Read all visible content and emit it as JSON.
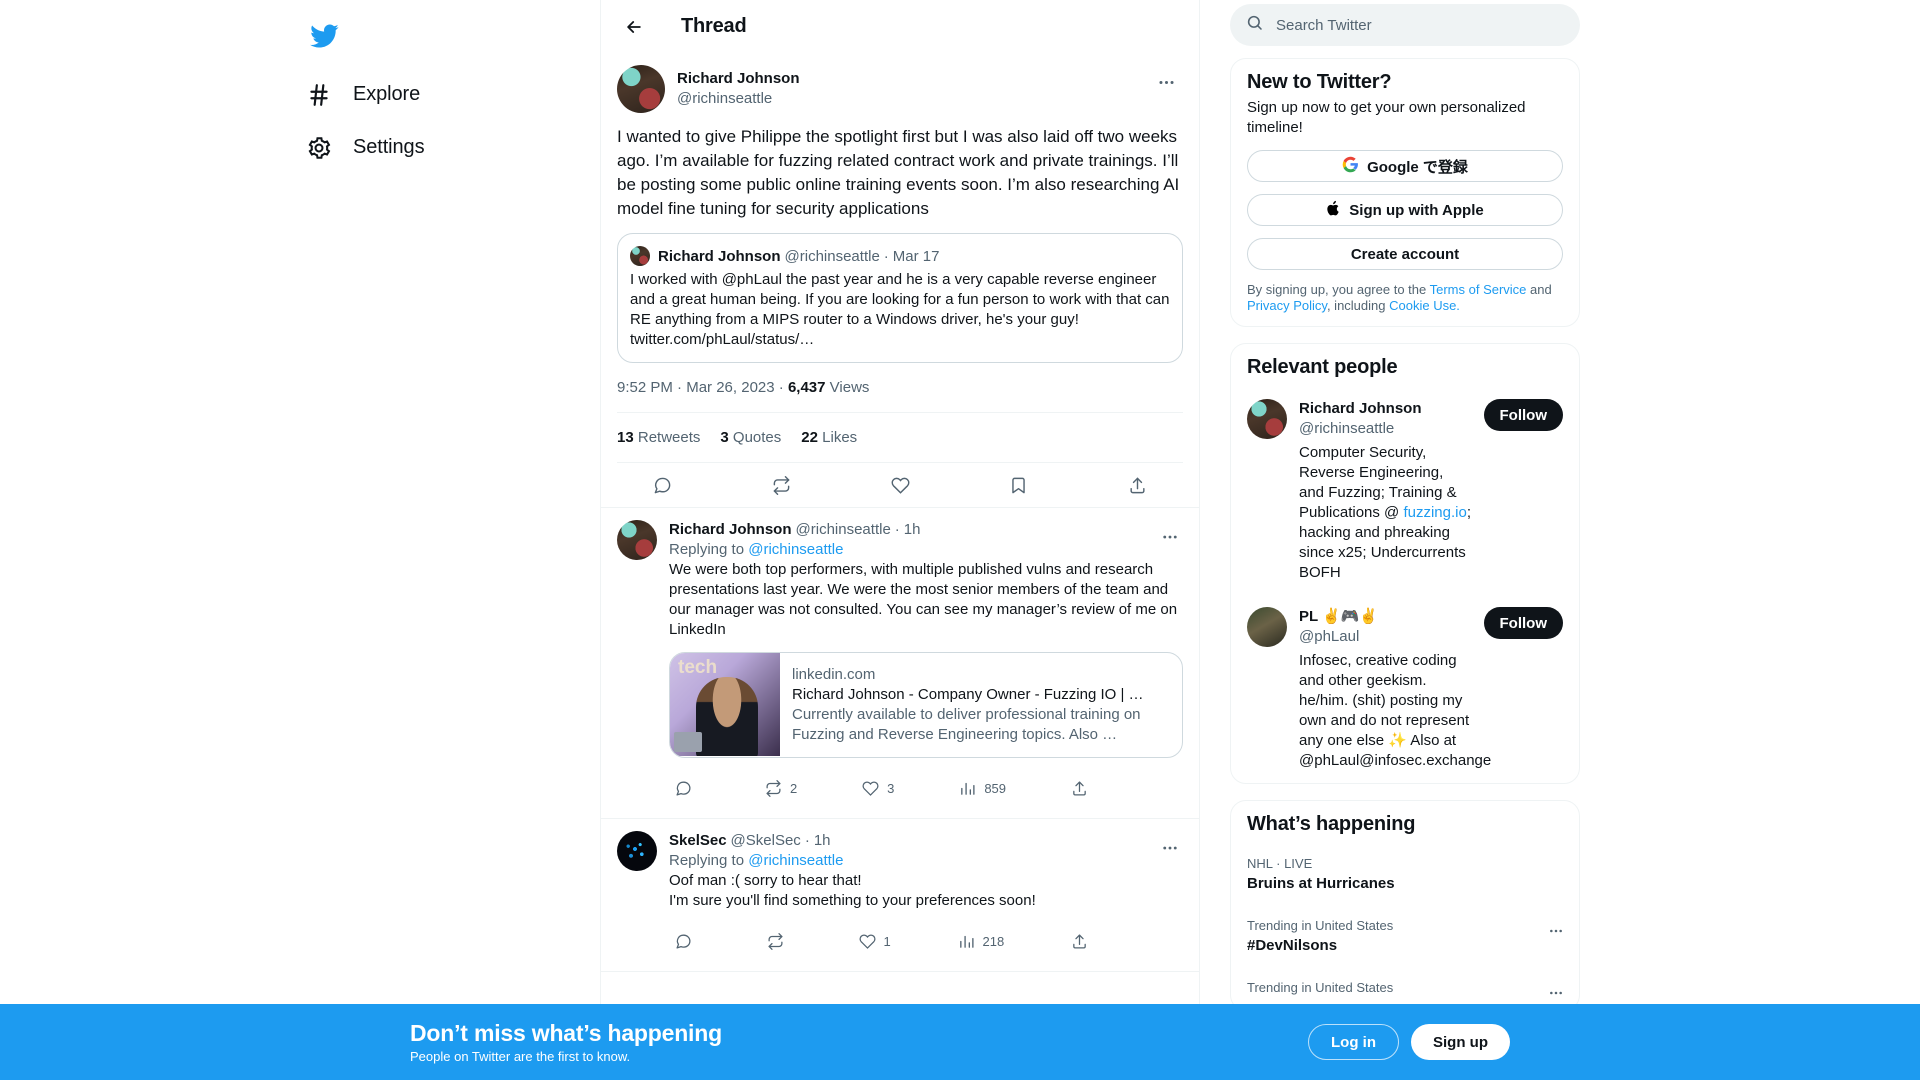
{
  "nav": {
    "logo_icon": "twitter-bird-icon",
    "items": [
      {
        "label": "Explore",
        "icon": "hashtag-icon"
      },
      {
        "label": "Settings",
        "icon": "gear-icon"
      }
    ]
  },
  "thread": {
    "header_title": "Thread",
    "back_icon": "back-arrow-icon",
    "main_tweet": {
      "author_name": "Richard Johnson",
      "author_handle": "@richinseattle",
      "text": "I wanted to give Philippe the spotlight first but I was also laid off two weeks ago. I’m available for fuzzing related contract work and private trainings. I’ll be posting some public online training events soon. I’m also researching AI model fine tuning for security applications",
      "quote": {
        "author_name": "Richard Johnson",
        "author_handle": "@richinseattle",
        "date": "Mar 17",
        "separator": "·",
        "text": "I worked with @phLaul the past year and he is a very capable reverse engineer and a great human being. If you are looking for a fun person to work with that can RE anything from a MIPS router to a Windows driver, he's your guy! twitter.com/phLaul/status/…"
      },
      "time": "9:52 PM",
      "date": "Mar 26, 2023",
      "views_count": "6,437",
      "views_label": "Views",
      "stats": [
        {
          "count": "13",
          "label": "Retweets"
        },
        {
          "count": "3",
          "label": "Quotes"
        },
        {
          "count": "22",
          "label": "Likes"
        }
      ],
      "actions": [
        {
          "icon": "reply-icon",
          "count": ""
        },
        {
          "icon": "retweet-icon",
          "count": ""
        },
        {
          "icon": "like-icon",
          "count": ""
        },
        {
          "icon": "bookmark-icon",
          "count": ""
        },
        {
          "icon": "share-icon",
          "count": ""
        }
      ]
    },
    "replies": [
      {
        "author_name": "Richard Johnson",
        "author_handle": "@richinseattle",
        "separator": "·",
        "time_ago": "1h",
        "replying_prefix": "Replying to",
        "replying_to": "@richinseattle",
        "text": "We were both top performers, with multiple published vulns and research presentations last year. We were the most senior members of the team and our manager was not consulted. You can see my manager’s review of me on LinkedIn",
        "link_card": {
          "thumb_text": "tech",
          "domain": "linkedin.com",
          "title": "Richard Johnson - Company Owner - Fuzzing IO | …",
          "description": "Currently available to deliver professional training on Fuzzing and Reverse Engineering topics. Also …"
        },
        "actions": [
          {
            "icon": "reply-icon",
            "count": ""
          },
          {
            "icon": "retweet-icon",
            "count": "2"
          },
          {
            "icon": "like-icon",
            "count": "3"
          },
          {
            "icon": "views-icon",
            "count": "859"
          },
          {
            "icon": "share-icon",
            "count": ""
          }
        ]
      },
      {
        "author_name": "SkelSec",
        "author_handle": "@SkelSec",
        "separator": "·",
        "time_ago": "1h",
        "replying_prefix": "Replying to",
        "replying_to": "@richinseattle",
        "text": "Oof man :( sorry to hear that!\nI'm sure you'll find something to your preferences soon!",
        "actions": [
          {
            "icon": "reply-icon",
            "count": ""
          },
          {
            "icon": "retweet-icon",
            "count": ""
          },
          {
            "icon": "like-icon",
            "count": "1"
          },
          {
            "icon": "views-icon",
            "count": "218"
          },
          {
            "icon": "share-icon",
            "count": ""
          }
        ]
      }
    ]
  },
  "search": {
    "placeholder": "Search Twitter",
    "icon": "search-icon"
  },
  "signup_card": {
    "title": "New to Twitter?",
    "subtitle": "Sign up now to get your own personalized timeline!",
    "google_label": "Google で登録",
    "apple_label": "Sign up with Apple",
    "create_label": "Create account",
    "legal_prefix": "By signing up, you agree to the ",
    "terms": "Terms of Service",
    "legal_and": " and ",
    "privacy": "Privacy Policy",
    "legal_including": ", including ",
    "cookie": "Cookie Use."
  },
  "relevant_people": {
    "title": "Relevant people",
    "people": [
      {
        "name": "Richard Johnson",
        "handle": "@richinseattle",
        "bio_1": "Computer Security, Reverse Engineering, and Fuzzing; Training & Publications @ ",
        "bio_link": "fuzzing.io",
        "bio_2": "; hacking and phreaking since x25; Undercurrents BOFH",
        "follow_label": "Follow"
      },
      {
        "name": "PL ✌️🎮✌️",
        "handle": "@phLaul",
        "bio_1": "Infosec, creative coding and other geekism. he/him. (shit) posting my own and do not represent any one else ✨ Also at @phLaul@infosec.exchange",
        "bio_link": "",
        "bio_2": "",
        "follow_label": "Follow"
      }
    ]
  },
  "whats_happening": {
    "title": "What’s happening",
    "items": [
      {
        "category": "NHL · LIVE",
        "name": "Bruins at Hurricanes",
        "has_dots": false
      },
      {
        "category": "Trending in United States",
        "name": "#DevNilsons",
        "has_dots": true
      },
      {
        "category": "Trending in United States",
        "name": "",
        "has_dots": true
      }
    ]
  },
  "banner": {
    "headline": "Don’t miss what’s happening",
    "subtext": "People on Twitter are the first to know.",
    "login_label": "Log in",
    "signup_label": "Sign up",
    "bg_color": "#1d9bf0"
  }
}
